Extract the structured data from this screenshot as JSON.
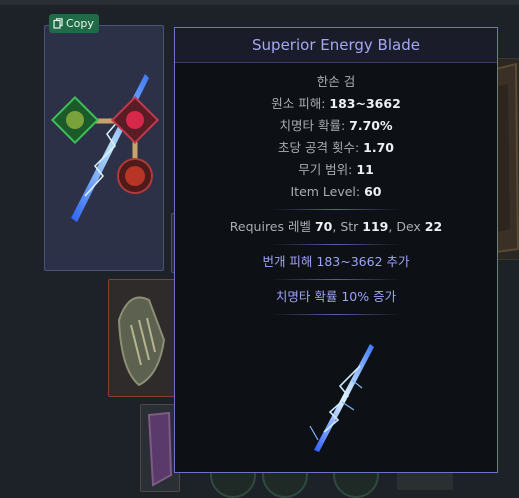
{
  "copy_button": {
    "label": "Copy",
    "icon": "copy-icon"
  },
  "tooltip": {
    "title": "Superior Energy Blade",
    "item_class": "한손 검",
    "stats": [
      {
        "label": "원소 피해: ",
        "value": "183~3662"
      },
      {
        "label": "치명타 확률: ",
        "value": "7.70%"
      },
      {
        "label": "초당 공격 횟수: ",
        "value": "1.70"
      },
      {
        "label": "무기 범위: ",
        "value": "11"
      },
      {
        "label": "Item Level: ",
        "value": "60"
      }
    ],
    "requirements": {
      "prefix": "Requires 레벨 ",
      "level": "70",
      "str_label": ", Str ",
      "str": "119",
      "dex_label": ", Dex ",
      "dex": "22"
    },
    "mods": [
      "번개 피해 183~3662 추가",
      "치명타 확률 10% 증가"
    ]
  },
  "colors": {
    "tooltip_border": "#6e72c7",
    "title": "#a4a8f2",
    "magic_mod": "#9ea4f5",
    "copy_button_bg": "#1f6b47"
  }
}
